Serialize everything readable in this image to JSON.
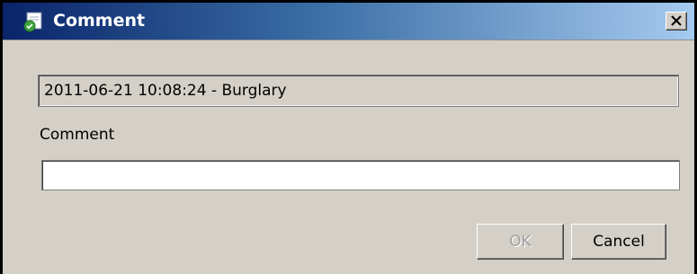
{
  "window": {
    "title": "Comment",
    "close_glyph": "✕",
    "title_icon": "comment-document-icon"
  },
  "event": {
    "summary": "2011-06-21 10:08:24 - Burglary"
  },
  "comment": {
    "label": "Comment",
    "value": "",
    "placeholder": ""
  },
  "buttons": {
    "ok_label": "OK",
    "ok_enabled": false,
    "cancel_label": "Cancel"
  },
  "colors": {
    "titlebar_start": "#0a246a",
    "titlebar_end": "#a6caf0",
    "dialog_background": "#d4d0c8"
  }
}
